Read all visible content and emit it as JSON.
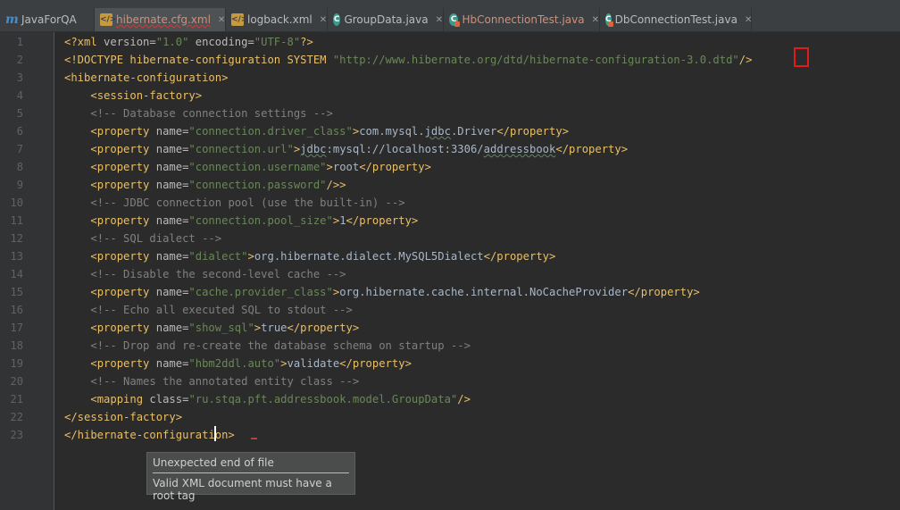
{
  "tabs": [
    {
      "label": "JavaForQA",
      "icon": "module-icon",
      "glyph": "m",
      "active": false
    },
    {
      "label": "hibernate.cfg.xml",
      "icon": "xml-file-icon",
      "glyph": "</>",
      "active": true
    },
    {
      "label": "logback.xml",
      "icon": "xml-file-icon",
      "glyph": "</>",
      "active": false
    },
    {
      "label": "GroupData.java",
      "icon": "java-class-icon",
      "glyph": "C",
      "active": false
    },
    {
      "label": "HbConnectionTest.java",
      "icon": "java-test-class-icon",
      "glyph": "C",
      "active": false
    },
    {
      "label": "DbConnectionTest.java",
      "icon": "java-test-class-icon",
      "glyph": "C",
      "active": false
    }
  ],
  "close_glyph": "✕",
  "gutter": {
    "line_numbers": [
      "1",
      "2",
      "3",
      "4",
      "5",
      "6",
      "7",
      "8",
      "9",
      "10",
      "11",
      "12",
      "13",
      "14",
      "15",
      "16",
      "17",
      "18",
      "19",
      "20",
      "21",
      "22",
      "23"
    ]
  },
  "code": {
    "l1": {
      "a": "<?xml ",
      "b": "version=",
      "c": "\"1.0\"",
      "d": " encoding=",
      "e": "\"UTF-8\"",
      "f": "?>"
    },
    "l2": {
      "a": "<!DOCTYPE hibernate-configuration SYSTEM ",
      "b": "\"http://www.hibernate.org/dtd/hibernate-configuration-3.0.dtd\"",
      "c": "/>"
    },
    "l3": {
      "a": "<hibernate-configuration>"
    },
    "l4": {
      "a": "<session-factory>"
    },
    "l5": {
      "a": "<!-- Database connection settings -->"
    },
    "l6": {
      "a": "<property ",
      "b": "name=",
      "c": "\"connection.driver_class\"",
      "d": ">",
      "e": "com.mysql.",
      "f": "jdbc",
      "g": ".Driver",
      "h": "</property>"
    },
    "l7": {
      "a": "<property ",
      "b": "name=",
      "c": "\"connection.url\"",
      "d": ">",
      "e": "jdbc",
      "f": ":mysql://localhost:3306/",
      "g": "addressbook",
      "h": "</property>"
    },
    "l8": {
      "a": "<property ",
      "b": "name=",
      "c": "\"connection.username\"",
      "d": ">",
      "e": "root",
      "f": "</property>"
    },
    "l9": {
      "a": "<property ",
      "b": "name=",
      "c": "\"connection.password\"",
      "d": "/>>"
    },
    "l10": {
      "a": "<!-- JDBC connection pool (use the built-in) -->"
    },
    "l11": {
      "a": "<property ",
      "b": "name=",
      "c": "\"connection.pool_size\"",
      "d": ">",
      "e": "1",
      "f": "</property>"
    },
    "l12": {
      "a": "<!-- SQL dialect -->"
    },
    "l13": {
      "a": "<property ",
      "b": "name=",
      "c": "\"dialect\"",
      "d": ">",
      "e": "org.hibernate.dialect.MySQL5Dialect",
      "f": "</property>"
    },
    "l14": {
      "a": "<!-- Disable the second-level cache -->"
    },
    "l15": {
      "a": "<property ",
      "b": "name=",
      "c": "\"cache.provider_class\"",
      "d": ">",
      "e": "org.hibernate.cache.internal.NoCacheProvider",
      "f": "</property>"
    },
    "l16": {
      "a": "<!-- Echo all executed SQL to stdout -->"
    },
    "l17": {
      "a": "<property ",
      "b": "name=",
      "c": "\"show_sql\"",
      "d": ">",
      "e": "true",
      "f": "</property>"
    },
    "l18": {
      "a": "<!-- Drop and re-create the database schema on startup -->"
    },
    "l19": {
      "a": "<property ",
      "b": "name=",
      "c": "\"hbm2ddl.auto\"",
      "d": ">",
      "e": "validate",
      "f": "</property>"
    },
    "l20": {
      "a": "<!-- Names the annotated entity class -->"
    },
    "l21": {
      "a": "<mapping ",
      "b": "class=",
      "c": "\"ru.stqa.pft.addressbook.model.GroupData\"",
      "d": "/>"
    },
    "l22": {
      "a": "</session-factory>"
    },
    "l23": {
      "a": "</hibernate-configuration>"
    }
  },
  "tooltip": {
    "title": "Unexpected end of file",
    "message": "Valid XML document must have a root tag"
  },
  "colors": {
    "tag": "#e8bf6a",
    "attr_value": "#6a8759",
    "comment": "#808080",
    "text": "#a9b7c6",
    "highlight": "#e31b1b"
  }
}
